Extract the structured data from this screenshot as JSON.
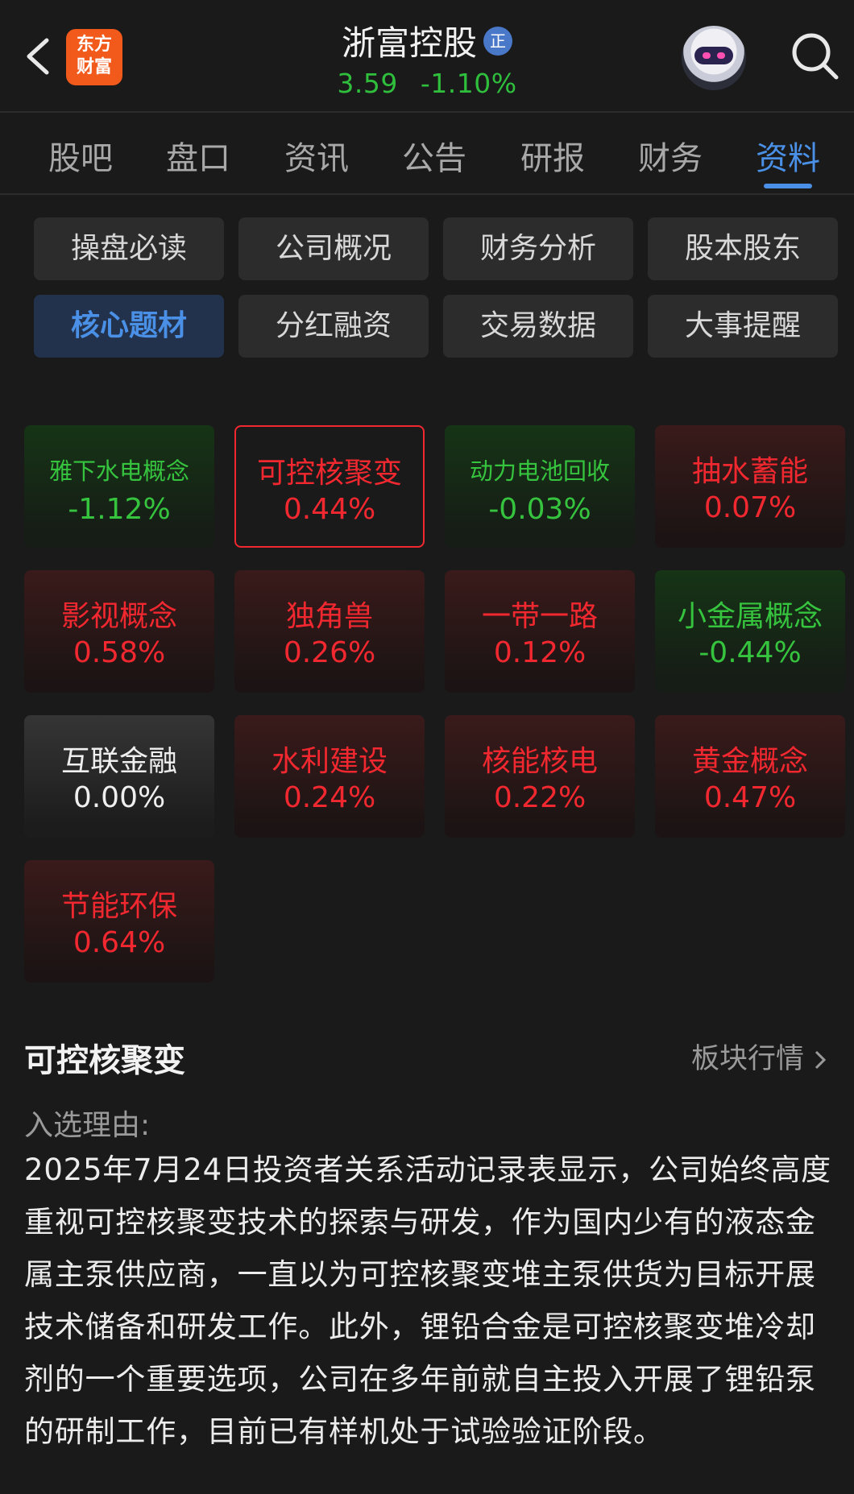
{
  "header": {
    "logo_line1": "东方",
    "logo_line2": "财富",
    "stock_name": "浙富控股",
    "badge": "正",
    "price": "3.59",
    "change": "-1.10%"
  },
  "tabs": [
    "股吧",
    "盘口",
    "资讯",
    "公告",
    "研报",
    "财务",
    "资料"
  ],
  "active_tab": "资料",
  "sub_buttons": [
    "操盘必读",
    "公司概况",
    "财务分析",
    "股本股东",
    "核心题材",
    "分红融资",
    "交易数据",
    "大事提醒"
  ],
  "active_sub_button": "核心题材",
  "themes": [
    {
      "name": "雅下水电概念",
      "pct": "-1.12%",
      "trend": "down"
    },
    {
      "name": "可控核聚变",
      "pct": "0.44%",
      "trend": "up",
      "selected": true
    },
    {
      "name": "动力电池回收",
      "pct": "-0.03%",
      "trend": "down"
    },
    {
      "name": "抽水蓄能",
      "pct": "0.07%",
      "trend": "up"
    },
    {
      "name": "影视概念",
      "pct": "0.58%",
      "trend": "up"
    },
    {
      "name": "独角兽",
      "pct": "0.26%",
      "trend": "up"
    },
    {
      "name": "一带一路",
      "pct": "0.12%",
      "trend": "up"
    },
    {
      "name": "小金属概念",
      "pct": "-0.44%",
      "trend": "down"
    },
    {
      "name": "互联金融",
      "pct": "0.00%",
      "trend": "flat"
    },
    {
      "name": "水利建设",
      "pct": "0.24%",
      "trend": "up"
    },
    {
      "name": "核能核电",
      "pct": "0.22%",
      "trend": "up"
    },
    {
      "name": "黄金概念",
      "pct": "0.47%",
      "trend": "up"
    },
    {
      "name": "节能环保",
      "pct": "0.64%",
      "trend": "up"
    }
  ],
  "detail": {
    "title": "可控核聚变",
    "link": "板块行情",
    "reason_label": "入选理由:",
    "reason_text": "2025年7月24日投资者关系活动记录表显示，公司始终高度重视可控核聚变技术的探索与研发，作为国内少有的液态金属主泵供应商，一直以为可控核聚变堆主泵供货为目标开展技术储备和研发工作。此外，锂铅合金是可控核聚变堆冷却剂的一个重要选项，公司在多年前就自主投入开展了锂铅泵的研制工作，目前已有样机处于试验验证阶段。"
  },
  "colors": {
    "up": "#f1282f",
    "down": "#36c43f",
    "accent": "#4a90e6",
    "background": "#1a1a1a"
  }
}
